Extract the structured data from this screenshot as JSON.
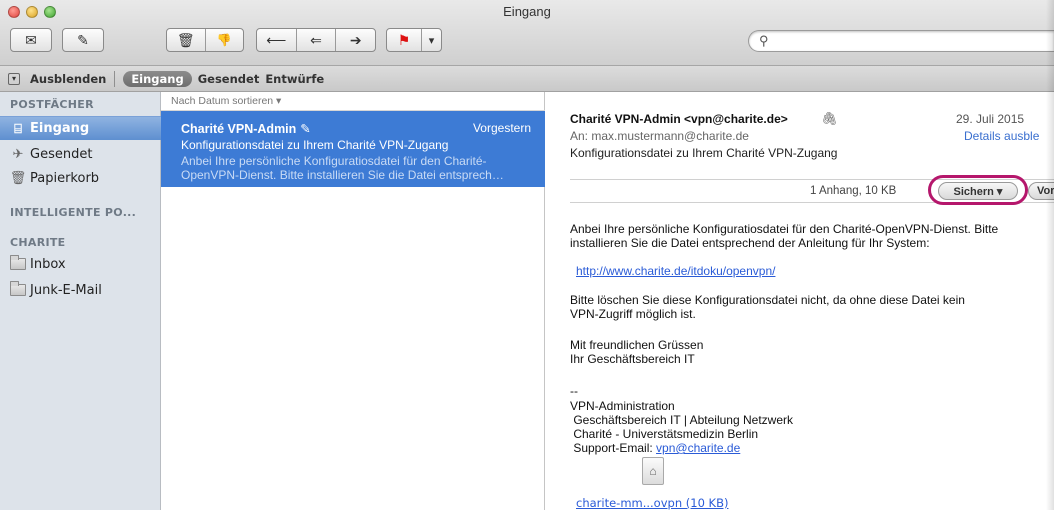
{
  "window": {
    "title": "Eingang"
  },
  "toolbar": {
    "buttons": [
      {
        "name": "get-mail-button",
        "icon": "envelope-icon",
        "glyph": "✉"
      },
      {
        "name": "compose-button",
        "icon": "compose-icon",
        "glyph": "✎"
      },
      {
        "name": "delete-button",
        "icon": "trash-icon",
        "glyph": "🗑"
      },
      {
        "name": "junk-button",
        "icon": "thumbs-down-icon",
        "glyph": "👎"
      },
      {
        "name": "reply-button",
        "icon": "reply-icon",
        "glyph": "⟵"
      },
      {
        "name": "reply-all-button",
        "icon": "reply-all-icon",
        "glyph": "⇐"
      },
      {
        "name": "forward-button",
        "icon": "forward-icon",
        "glyph": "➔"
      },
      {
        "name": "flag-button",
        "icon": "flag-icon",
        "glyph": "⚑"
      },
      {
        "name": "flag-menu-button",
        "icon": "chevron-down-icon",
        "glyph": "▾"
      }
    ],
    "search": {
      "placeholder": "",
      "icon": "search-icon"
    }
  },
  "favorites": {
    "hide_label": "Ausblenden",
    "items": [
      {
        "label": "Eingang",
        "selected": true
      },
      {
        "label": "Gesendet",
        "selected": false
      },
      {
        "label": "Entwürfe",
        "selected": false
      }
    ]
  },
  "sidebar": {
    "sections": [
      {
        "header": "POSTFÄCHER",
        "items": [
          {
            "label": "Eingang",
            "icon": "inbox-icon",
            "selected": true
          },
          {
            "label": "Gesendet",
            "icon": "sent-icon",
            "selected": false
          },
          {
            "label": "Papierkorb",
            "icon": "trash-icon",
            "selected": false
          }
        ]
      },
      {
        "header": "INTELLIGENTE PO...",
        "items": []
      },
      {
        "header": "CHARITE",
        "items": [
          {
            "label": "Inbox",
            "icon": "folder-icon",
            "selected": false
          },
          {
            "label": "Junk-E-Mail",
            "icon": "folder-icon",
            "selected": false
          }
        ]
      }
    ]
  },
  "message_list": {
    "sort_label": "Nach Datum sortieren ▾",
    "messages": [
      {
        "from": "Charité VPN-Admin",
        "has_attachment": true,
        "date": "Vorgestern",
        "subject": "Konfigurationsdatei zu Ihrem Charité VPN-Zugang",
        "preview_line1": "Anbei Ihre persönliche Konfiguratiosdatei für den Charité-",
        "preview_line2": "OpenVPN-Dienst. Bitte installieren Sie die Datei entsprech…",
        "selected": true
      }
    ]
  },
  "viewer": {
    "from": "Charité VPN-Admin <vpn@charite.de>",
    "date": "29. Juli 2015",
    "to": "An:  max.mustermann@charite.de",
    "details_link": "Details ausble",
    "subject": "Konfigurationsdatei zu Ihrem Charité VPN-Zugang",
    "attachment_info": "1 Anhang, 10 KB",
    "save_label": "Sichern ▾",
    "quicklook_label": "Vorsch",
    "body": {
      "p1_line1": "Anbei Ihre persönliche Konfiguratiosdatei für den Charité-OpenVPN-Dienst. Bitte",
      "p1_line2": "installieren Sie die Datei entsprechend der Anleitung für Ihr System:",
      "link": "http://www.charite.de/itdoku/openvpn/",
      "p2_line1": "Bitte löschen Sie diese Konfigurationsdatei nicht, da ohne diese Datei kein",
      "p2_line2": "VPN-Zugriff möglich ist.",
      "greeting1": "Mit freundlichen Grüssen",
      "greeting2": "Ihr Geschäftsbereich IT",
      "sig_dash": "--",
      "sig1": "VPN-Administration",
      "sig2": " Geschäftsbereich IT | Abteilung Netzwerk",
      "sig3": " Charité - Universtätsmedizin Berlin",
      "sig4_prefix": " Support-Email: ",
      "sig4_link": "vpn@charite.de"
    },
    "attachment_name": "charite-mm...ovpn (10 KB)"
  }
}
